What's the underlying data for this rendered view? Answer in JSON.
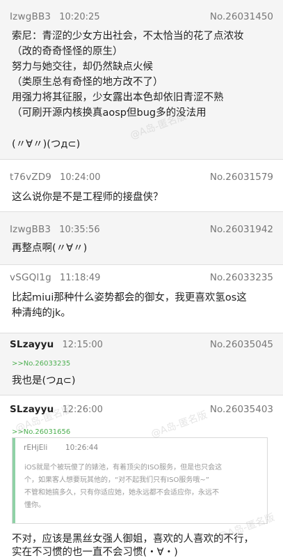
{
  "posts": [
    {
      "uid": "IzwgBB3",
      "time": "10:20:25",
      "no": "No.26031450",
      "lines": [
        "索尼：青涩的少女方出社会，不太恰当的花了点浓妆",
        "（改的奇奇怪怪的原生）",
        "努力与她交往，却仍然缺点火候",
        "（类原生总有奇怪的地方改不了）",
        "用强力将其征服，少女露出本色却依旧青涩不熟",
        "（可刷开源内核换真aosp但bug多的没法用",
        "(〃∀〃)(つд⊂)"
      ]
    },
    {
      "uid": "t76vZD9",
      "time": "10:24:00",
      "no": "No.26031579",
      "lines": [
        "这么说你是不是工程师的接盘侠？"
      ]
    },
    {
      "uid": "IzwgBB3",
      "time": "10:35:56",
      "no": "No.26031942",
      "lines": [
        "再整点啊(〃∀〃)"
      ]
    },
    {
      "uid": "vSGQl1g",
      "time": "11:18:49",
      "no": "No.26033235",
      "lines": [
        "比起miui那种什么姿势都会的御女，我更喜欢氢os这",
        "种清纯的jk。"
      ]
    },
    {
      "uid": "SLzayyu",
      "time": "12:15:00",
      "no": "No.26035045",
      "ref": ">>No.26033235",
      "lines": [
        "我也是(つд⊂)"
      ]
    },
    {
      "uid": "SLzayyu",
      "time": "12:26:00",
      "no": "No.26035403",
      "ref": ">>No.26031656",
      "quote": {
        "uid": "rEHjEli",
        "time": "10:26:44",
        "lines": [
          "iOS就是个被玩傻了的婊池，有着顶尖的ISO服务，但是也只会这",
          "个，如果客人想要玩其他的，“对不起我们只有ISO服务哦~”",
          "不管和她搞多久，只有你适应她，她永远都不会适应你，永远不",
          "懂你。"
        ]
      },
      "lines": [
        "不对，应该是黑丝女强人御姐，喜欢的人喜欢的不行，",
        "实在不习惯的也一直不会习惯(・∀・)"
      ]
    }
  ],
  "watermark": "@A岛-匿名版"
}
